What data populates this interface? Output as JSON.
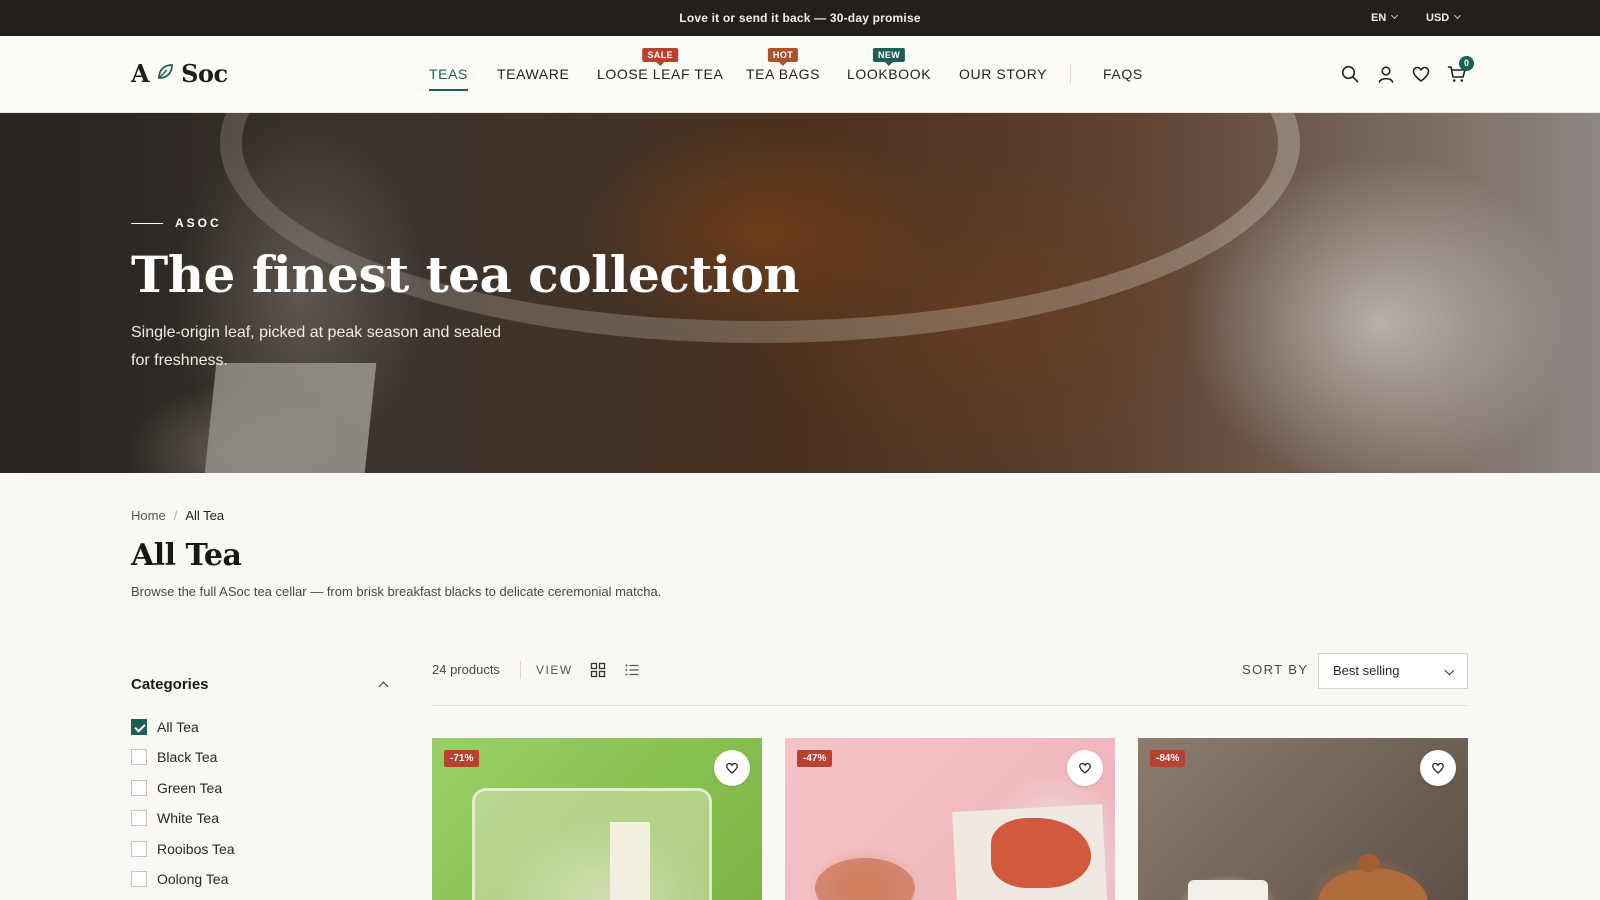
{
  "announcement": {
    "text": "Love it or send it back — 30-day promise",
    "language": "EN",
    "currency": "USD"
  },
  "header": {
    "logo_left": "A",
    "logo_right": "Soc",
    "cart_count": "0",
    "nav": [
      {
        "label": "TEAS",
        "badge": ""
      },
      {
        "label": "TEAWARE",
        "badge": ""
      },
      {
        "label": "LOOSE LEAF TEA",
        "badge": "SALE"
      },
      {
        "label": "TEA BAGS",
        "badge": "HOT"
      },
      {
        "label": "LOOKBOOK",
        "badge": "NEW"
      },
      {
        "label": "OUR STORY",
        "badge": ""
      },
      {
        "label": "FAQS",
        "badge": ""
      }
    ],
    "badge_colors": {
      "sale": "#b8412f",
      "hot": "#a9532b",
      "new": "#1c5f57"
    },
    "icons": [
      "search-icon",
      "account-icon",
      "heart-icon",
      "cart-icon"
    ]
  },
  "hero": {
    "eyebrow": "ASOC",
    "title": "The finest tea collection",
    "subtitle": "Single-origin leaf, picked at peak season and sealed for freshness."
  },
  "breadcrumb": {
    "home": "Home",
    "separator": "/",
    "current": "All Tea"
  },
  "page": {
    "title": "All Tea",
    "description": "Browse the full ASoc tea cellar — from brisk breakfast blacks to delicate ceremonial matcha."
  },
  "sidebar": {
    "heading": "Categories",
    "items": [
      {
        "label": "All Tea",
        "checked": true
      },
      {
        "label": "Black Tea",
        "checked": false
      },
      {
        "label": "Green Tea",
        "checked": false
      },
      {
        "label": "White Tea",
        "checked": false
      },
      {
        "label": "Rooibos Tea",
        "checked": false
      },
      {
        "label": "Oolong Tea",
        "checked": false
      }
    ]
  },
  "toolbar": {
    "count": "24 products",
    "view_label": "VIEW",
    "sort_label": "SORT BY",
    "sort_value": "Best selling"
  },
  "products": [
    {
      "discount": "-71%"
    },
    {
      "discount": "-47%"
    },
    {
      "discount": "-84%"
    }
  ],
  "accent_color": "#1c5f57"
}
